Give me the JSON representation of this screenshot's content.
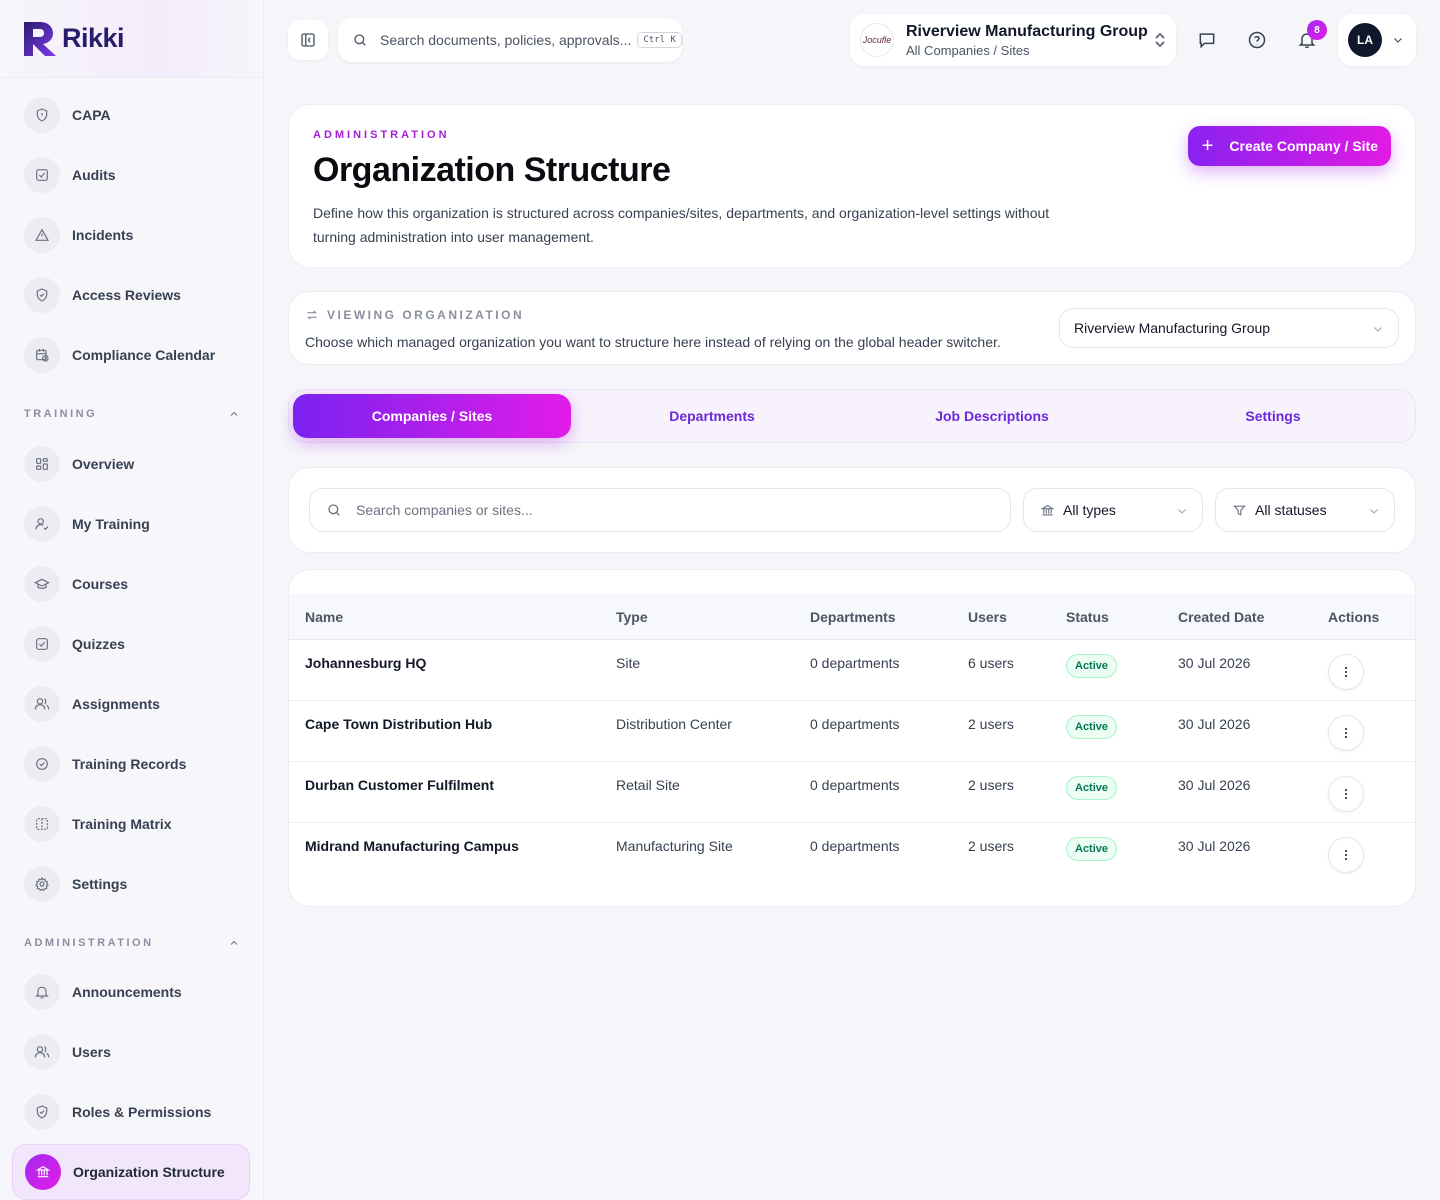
{
  "app": {
    "name": "Rikki"
  },
  "header": {
    "search_placeholder": "Search documents, policies, approvals...",
    "shortcut": "Ctrl K",
    "org_logo_text": "Jocufle",
    "org_name": "Riverview Manufacturing Group",
    "org_scope": "All Companies / Sites",
    "notification_count": "8",
    "user_initials": "LA"
  },
  "sidebar": {
    "top_items": [
      {
        "label": "CAPA",
        "icon": "shield-icon"
      },
      {
        "label": "Audits",
        "icon": "checkbox-icon"
      },
      {
        "label": "Incidents",
        "icon": "warning-icon"
      },
      {
        "label": "Access Reviews",
        "icon": "shield-check-icon"
      },
      {
        "label": "Compliance Calendar",
        "icon": "calendar-clock-icon"
      }
    ],
    "training_label": "TRAINING",
    "training_items": [
      {
        "label": "Overview",
        "icon": "grid-icon"
      },
      {
        "label": "My Training",
        "icon": "user-check-icon"
      },
      {
        "label": "Courses",
        "icon": "graduation-cap-icon"
      },
      {
        "label": "Quizzes",
        "icon": "checkbox-icon"
      },
      {
        "label": "Assignments",
        "icon": "users-icon"
      },
      {
        "label": "Training Records",
        "icon": "check-circle-icon"
      },
      {
        "label": "Training Matrix",
        "icon": "matrix-icon"
      },
      {
        "label": "Settings",
        "icon": "gear-icon"
      }
    ],
    "admin_label": "ADMINISTRATION",
    "admin_items": [
      {
        "label": "Announcements",
        "icon": "bell-icon"
      },
      {
        "label": "Users",
        "icon": "users-icon"
      },
      {
        "label": "Roles & Permissions",
        "icon": "shield-check-icon"
      },
      {
        "label": "Organization Structure",
        "icon": "building-icon"
      }
    ]
  },
  "hero": {
    "eyebrow": "ADMINISTRATION",
    "title": "Organization Structure",
    "description": "Define how this organization is structured across companies/sites, departments, and organization-level settings without turning administration into user management.",
    "create_button": "Create Company / Site"
  },
  "viewing": {
    "label": "VIEWING ORGANIZATION",
    "description": "Choose which managed organization you want to structure here instead of relying on the global header switcher.",
    "selected": "Riverview Manufacturing Group"
  },
  "tabs": [
    "Companies / Sites",
    "Departments",
    "Job Descriptions",
    "Settings"
  ],
  "filters": {
    "search_placeholder": "Search companies or sites...",
    "type": "All types",
    "status": "All statuses"
  },
  "table": {
    "columns": [
      "Name",
      "Type",
      "Departments",
      "Users",
      "Status",
      "Created Date",
      "Actions"
    ],
    "rows": [
      {
        "name": "Johannesburg HQ",
        "type": "Site",
        "departments": "0 departments",
        "users": "6 users",
        "status": "Active",
        "created": "30 Jul 2026"
      },
      {
        "name": "Cape Town Distribution Hub",
        "type": "Distribution Center",
        "departments": "0 departments",
        "users": "2 users",
        "status": "Active",
        "created": "30 Jul 2026"
      },
      {
        "name": "Durban Customer Fulfilment",
        "type": "Retail Site",
        "departments": "0 departments",
        "users": "2 users",
        "status": "Active",
        "created": "30 Jul 2026"
      },
      {
        "name": "Midrand Manufacturing Campus",
        "type": "Manufacturing Site",
        "departments": "0 departments",
        "users": "2 users",
        "status": "Active",
        "created": "30 Jul 2026"
      }
    ]
  },
  "colors": {
    "accent_start": "#8a22f0",
    "accent_end": "#e11be4",
    "brand_navy": "#2a1b6b",
    "status_active": "#047857"
  }
}
